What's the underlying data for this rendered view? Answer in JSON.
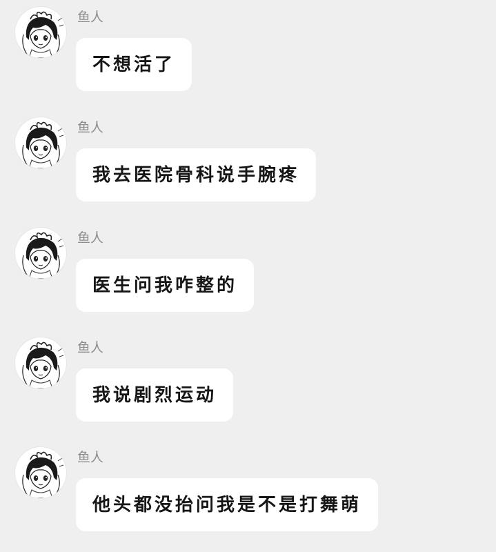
{
  "chat": {
    "messages": [
      {
        "sender": "鱼人",
        "text": "不想活了"
      },
      {
        "sender": "鱼人",
        "text": "我去医院骨科说手腕疼"
      },
      {
        "sender": "鱼人",
        "text": "医生问我咋整的"
      },
      {
        "sender": "鱼人",
        "text": "我说剧烈运动"
      },
      {
        "sender": "鱼人",
        "text": "他头都没抬问我是不是打舞萌"
      }
    ]
  },
  "icons": {
    "avatar": "anime-girl-avatar-icon"
  },
  "colors": {
    "background": "#efefef",
    "bubble": "#ffffff",
    "sender_name": "#8e8e8e",
    "message_text": "#161616"
  }
}
